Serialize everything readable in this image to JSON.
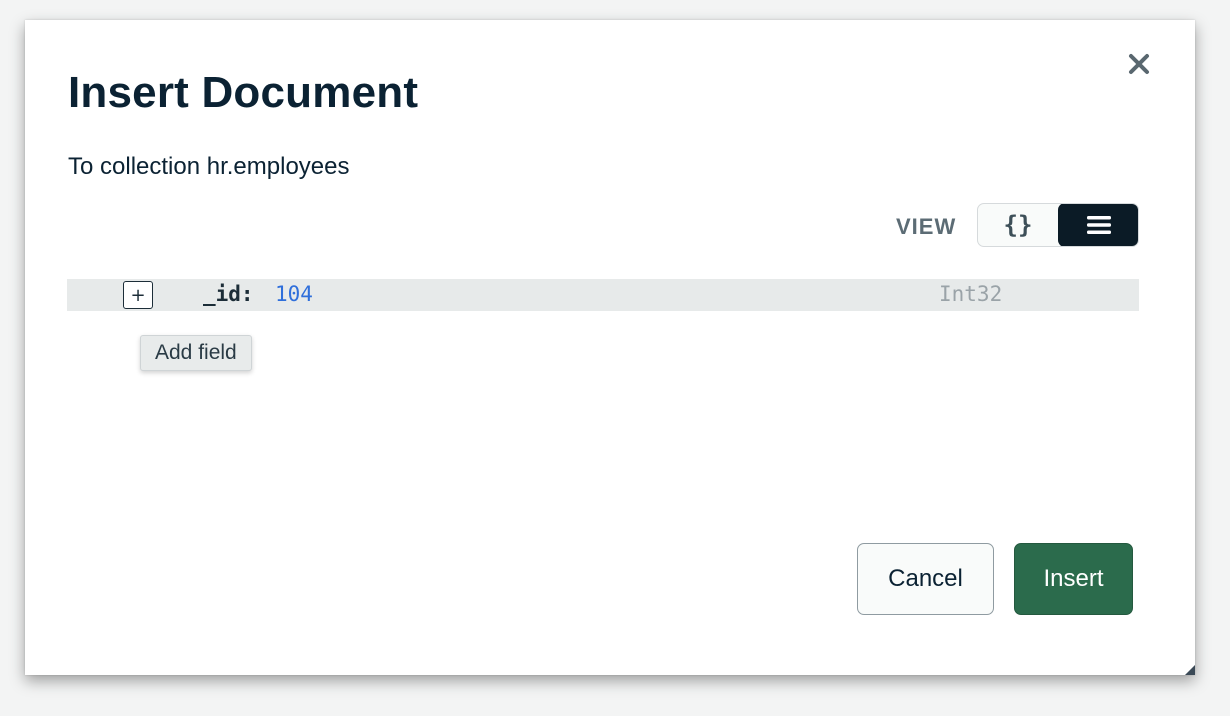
{
  "modal": {
    "title": "Insert Document",
    "subtitle": "To collection hr.employees",
    "close_icon": "close-icon"
  },
  "view": {
    "label": "VIEW",
    "json_glyph": "{}",
    "list_icon": "list-icon",
    "active": "list"
  },
  "document": {
    "fields": [
      {
        "key": "_id:",
        "value": "104",
        "type": "Int32"
      }
    ]
  },
  "tooltip": {
    "text": "Add field"
  },
  "footer": {
    "cancel_label": "Cancel",
    "insert_label": "Insert"
  },
  "colors": {
    "title": "#0b2233",
    "value": "#2f6fdb",
    "insert_bg": "#2b6b4c",
    "toggle_active_bg": "#0b1b26"
  }
}
